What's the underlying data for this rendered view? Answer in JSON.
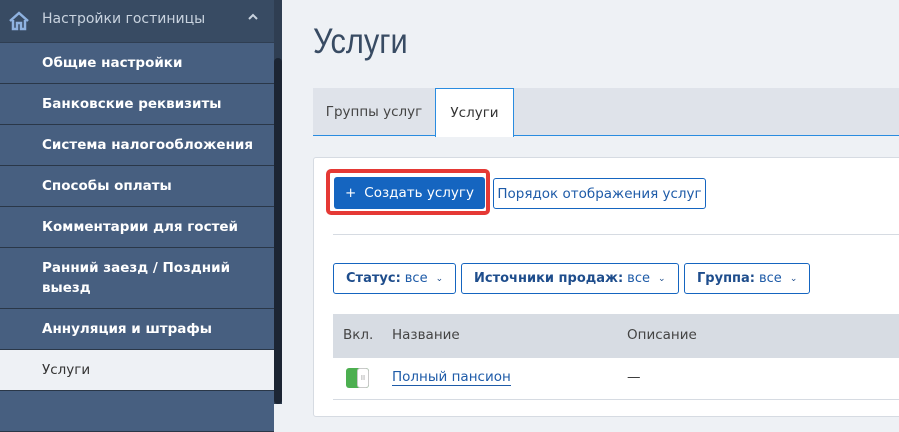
{
  "sidebar": {
    "section_title": "Настройки гостиницы",
    "items": [
      {
        "label": "Общие настройки"
      },
      {
        "label": "Банковские реквизиты"
      },
      {
        "label": "Система налогообложения"
      },
      {
        "label": "Способы оплаты"
      },
      {
        "label": "Комментарии для гостей"
      },
      {
        "label": "Ранний заезд / Поздний выезд"
      },
      {
        "label": "Аннуляция и штрафы"
      },
      {
        "label": "Услуги"
      }
    ]
  },
  "page": {
    "title": "Услуги"
  },
  "tabs": [
    {
      "label": "Группы услуг"
    },
    {
      "label": "Услуги"
    }
  ],
  "toolbar": {
    "create_label": "Создать услугу",
    "order_label": "Порядок отображения услуг"
  },
  "filters": [
    {
      "label": "Статус:",
      "value": "все"
    },
    {
      "label": "Источники продаж:",
      "value": "все"
    },
    {
      "label": "Группа:",
      "value": "все"
    }
  ],
  "table": {
    "columns": [
      "Вкл.",
      "Название",
      "Описание"
    ],
    "rows": [
      {
        "enabled": true,
        "name": "Полный пансион",
        "description": "—"
      }
    ]
  },
  "colors": {
    "accent": "#1565c0",
    "highlight": "#e53935",
    "toggle_on": "#4caf50"
  }
}
